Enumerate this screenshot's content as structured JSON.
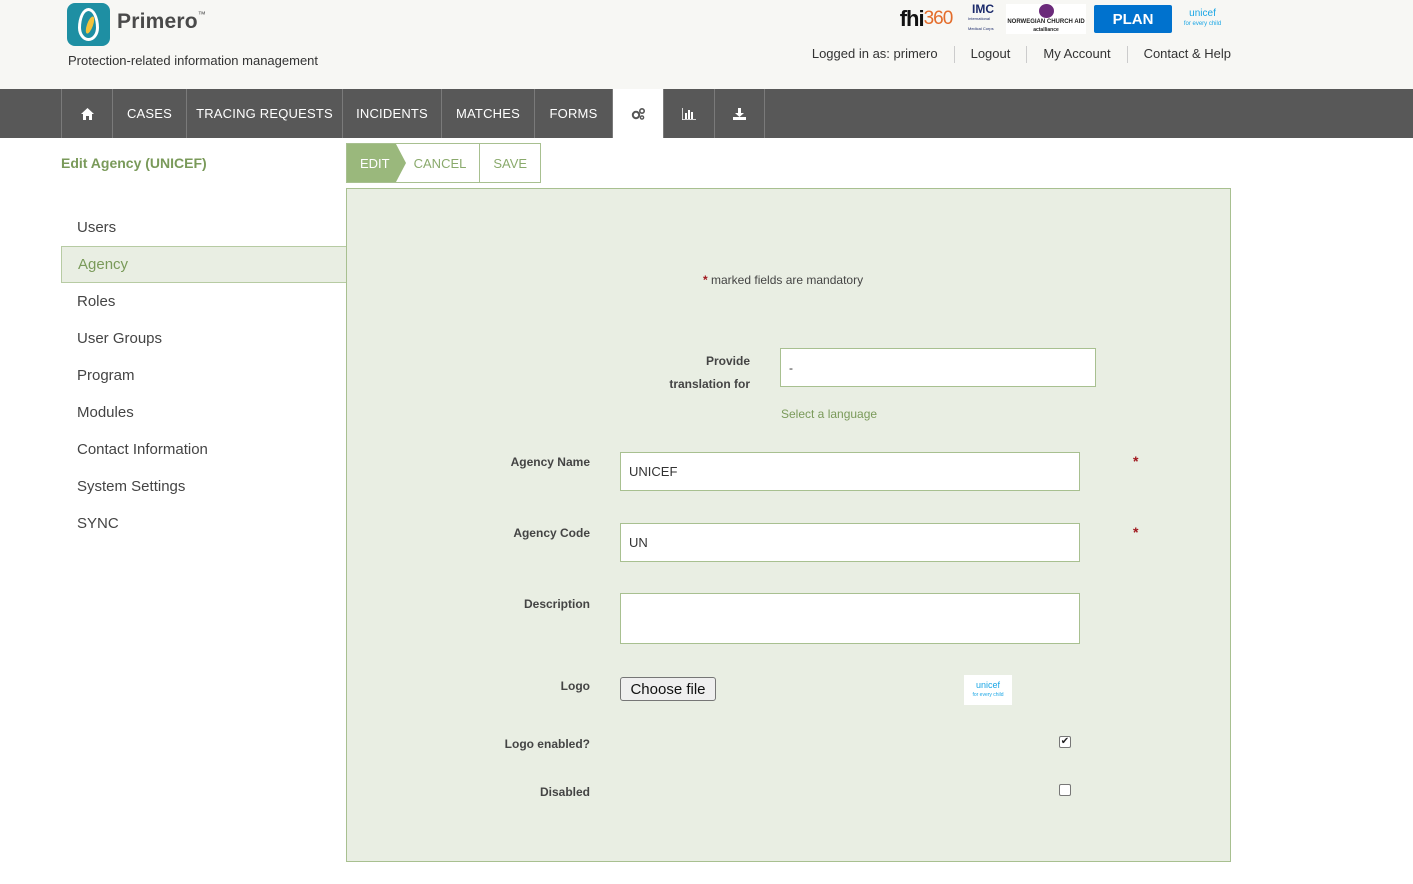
{
  "header": {
    "brand_name": "Primero",
    "brand_tm": "™",
    "tagline": "Protection-related information management",
    "partners": {
      "fhi": "fhi",
      "fhi_num": "360",
      "imc": "IMC",
      "imc_sub": "International Medical Corps",
      "nca": "NORWEGIAN CHURCH AID",
      "nca_sub": "actalliance",
      "plan": "PLAN",
      "unicef": "unicef",
      "unicef_sub": "for every child"
    },
    "user_links": {
      "logged_in": "Logged in as: primero",
      "logout": "Logout",
      "my_account": "My Account",
      "contact_help": "Contact & Help"
    }
  },
  "nav": {
    "home_icon": "home-icon",
    "cases": "CASES",
    "tracing_requests": "TRACING REQUESTS",
    "incidents": "INCIDENTS",
    "matches": "MATCHES",
    "forms": "FORMS",
    "settings_icon": "gears-icon",
    "reports_icon": "bar-chart-icon",
    "export_icon": "download-icon"
  },
  "page": {
    "title": "Edit Agency (UNICEF)"
  },
  "toolbar": {
    "edit": "EDIT",
    "cancel": "CANCEL",
    "save": "SAVE"
  },
  "sidebar": {
    "items": [
      {
        "label": "Users"
      },
      {
        "label": "Agency"
      },
      {
        "label": "Roles"
      },
      {
        "label": "User Groups"
      },
      {
        "label": "Program"
      },
      {
        "label": "Modules"
      },
      {
        "label": "Contact Information"
      },
      {
        "label": "System Settings"
      },
      {
        "label": "SYNC"
      }
    ],
    "active_index": 1
  },
  "form": {
    "mandatory_star": "*",
    "mandatory_note": "marked fields are mandatory",
    "translation_label_1": "Provide",
    "translation_label_2": "translation for",
    "translation_value": "-",
    "select_language": "Select a language",
    "agency_name_label": "Agency Name",
    "agency_name_value": "UNICEF",
    "agency_code_label": "Agency Code",
    "agency_code_value": "UN",
    "description_label": "Description",
    "description_value": "",
    "logo_label": "Logo",
    "choose_file": "Choose file",
    "logo_thumb": "unicef",
    "logo_thumb_sub": "for every child",
    "logo_enabled_label": "Logo enabled?",
    "logo_enabled_checked": true,
    "logo_enabled_mark": "✔",
    "disabled_label": "Disabled",
    "disabled_checked": false
  },
  "colors": {
    "accent_green": "#7a9a5a",
    "panel_bg": "#e9eee3",
    "nav_bg": "#585858",
    "required_red": "#a0181e"
  }
}
